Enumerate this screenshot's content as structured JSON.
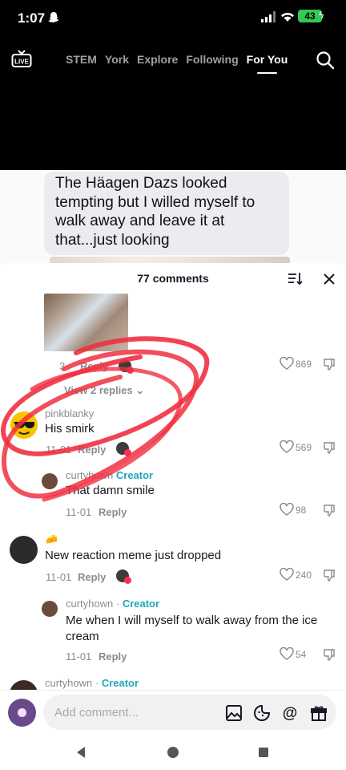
{
  "status_bar": {
    "time": "1:07",
    "battery": "43"
  },
  "top_nav": {
    "tabs": [
      "STEM",
      "York",
      "Explore",
      "Following",
      "For You"
    ],
    "active_tab": "For You",
    "live_label": "LIVE"
  },
  "caption": "The Häagen Dazs looked tempting but I willed myself to walk away and leave it at that...just looking",
  "comments_header": {
    "title": "77 comments"
  },
  "comment_1": {
    "date": "3",
    "reply_label": "Reply",
    "likes": "869",
    "view_replies": "View 2 replies ⌄"
  },
  "comment_2": {
    "username": "pinkblanky",
    "text": "His smirk",
    "date": "11-01",
    "reply_label": "Reply",
    "likes": "569"
  },
  "reply_2a": {
    "username": "curtyhown",
    "creator": "Creator",
    "text": "That damn smile",
    "date": "11-01",
    "reply_label": "Reply",
    "likes": "98"
  },
  "comment_3": {
    "text": "New reaction meme just dropped",
    "date": "11-01",
    "reply_label": "Reply",
    "likes": "240"
  },
  "reply_3a": {
    "username": "curtyhown",
    "separator": " · ",
    "creator": "Creator",
    "text": "Me when I will myself to walk away from the ice cream",
    "date": "11-01",
    "reply_label": "Reply",
    "likes": "54"
  },
  "reply_3b": {
    "username": "curtyhown",
    "separator": " · ",
    "creator": "Creator"
  },
  "input": {
    "placeholder": "Add comment..."
  },
  "colors": {
    "accent_red": "#fe2c55",
    "creator_teal": "#20a6b9",
    "annotation_red": "#f03040"
  }
}
